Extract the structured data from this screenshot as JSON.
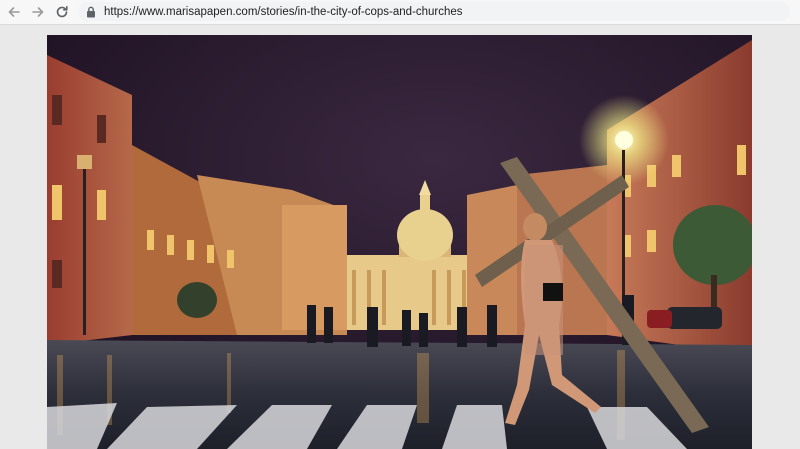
{
  "browser": {
    "back_icon": "arrow-left-icon",
    "forward_icon": "arrow-right-icon",
    "reload_icon": "reload-icon",
    "lock_icon": "lock-icon",
    "url": "https://www.marisapapen.com/stories/in-the-city-of-cops-and-churches"
  },
  "colors": {
    "sky": "#2a1a33",
    "street_light": "#f3f08a",
    "building_left": "#8a3b2e",
    "dome": "#e0c07a",
    "pavement": "#2b2f3c"
  }
}
